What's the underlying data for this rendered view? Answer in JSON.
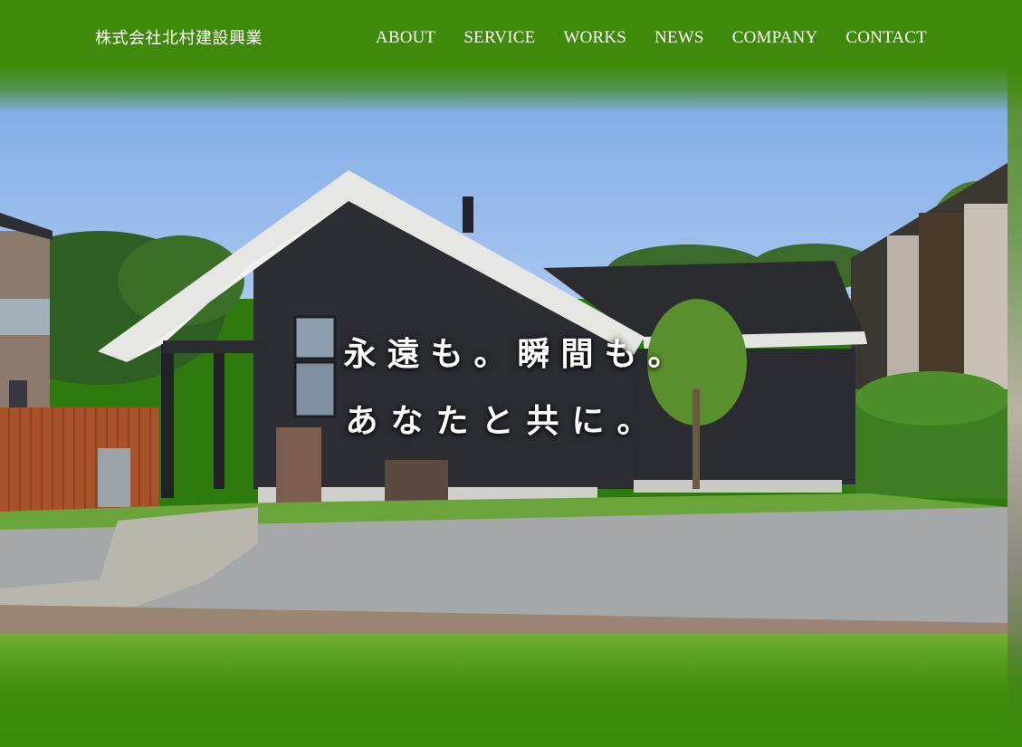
{
  "header": {
    "logo_text": "株式会社北村建設興業",
    "nav": [
      {
        "label": "ABOUT"
      },
      {
        "label": "SERVICE"
      },
      {
        "label": "WORKS"
      },
      {
        "label": "NEWS"
      },
      {
        "label": "COMPANY"
      },
      {
        "label": "CONTACT"
      }
    ]
  },
  "hero": {
    "line1": "永遠も。瞬間も。",
    "line2": "あなたと共に。"
  },
  "colors": {
    "brand_green": "#3f8a0b",
    "sky": "#7ea7e6",
    "house": "#2b2d33"
  }
}
